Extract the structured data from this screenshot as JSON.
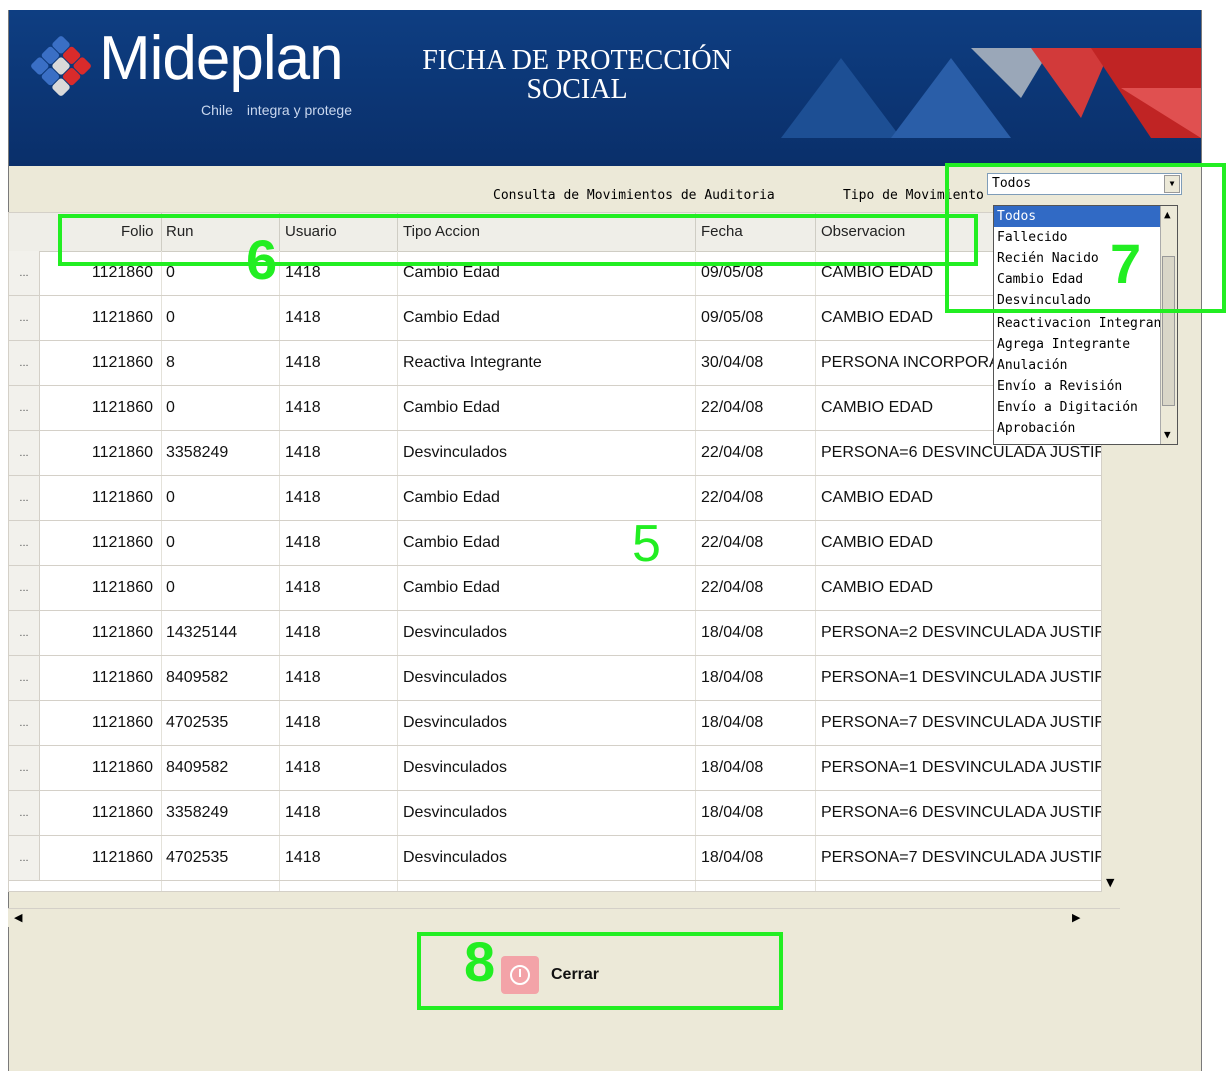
{
  "header": {
    "brand": "Mideplan",
    "tagline_left": "Chile",
    "tagline_right": "integra y protege",
    "title_line1": "FICHA DE PROTECCIÓN",
    "title_line2": "SOCIAL"
  },
  "toolbar": {
    "consulta_title": "Consulta de Movimientos de Auditoria",
    "tipo_label": "Tipo de Movimiento",
    "tipo_selected": "Todos"
  },
  "table": {
    "columns": [
      "Folio",
      "Run",
      "Usuario",
      "Tipo Accion",
      "Fecha",
      "Observacion"
    ],
    "rows": [
      [
        "1121860",
        "0",
        "1418",
        "Cambio Edad",
        "09/05/08",
        "CAMBIO EDAD"
      ],
      [
        "1121860",
        "0",
        "1418",
        "Cambio Edad",
        "09/05/08",
        "CAMBIO EDAD"
      ],
      [
        "1121860",
        "8",
        "1418",
        "Reactiva Integrante",
        "30/04/08",
        "PERSONA INCORPORAD"
      ],
      [
        "1121860",
        "0",
        "1418",
        "Cambio Edad",
        "22/04/08",
        "CAMBIO EDAD"
      ],
      [
        "1121860",
        "3358249",
        "1418",
        "Desvinculados",
        "22/04/08",
        "PERSONA=6 DESVINCULADA JUSTIF"
      ],
      [
        "1121860",
        "0",
        "1418",
        "Cambio Edad",
        "22/04/08",
        "CAMBIO EDAD"
      ],
      [
        "1121860",
        "0",
        "1418",
        "Cambio Edad",
        "22/04/08",
        "CAMBIO EDAD"
      ],
      [
        "1121860",
        "0",
        "1418",
        "Cambio Edad",
        "22/04/08",
        "CAMBIO EDAD"
      ],
      [
        "1121860",
        "14325144",
        "1418",
        "Desvinculados",
        "18/04/08",
        "PERSONA=2 DESVINCULADA JUSTIF"
      ],
      [
        "1121860",
        "8409582",
        "1418",
        "Desvinculados",
        "18/04/08",
        "PERSONA=1 DESVINCULADA JUSTIF"
      ],
      [
        "1121860",
        "4702535",
        "1418",
        "Desvinculados",
        "18/04/08",
        "PERSONA=7 DESVINCULADA JUSTIF"
      ],
      [
        "1121860",
        "8409582",
        "1418",
        "Desvinculados",
        "18/04/08",
        "PERSONA=1 DESVINCULADA JUSTIF"
      ],
      [
        "1121860",
        "3358249",
        "1418",
        "Desvinculados",
        "18/04/08",
        "PERSONA=6 DESVINCULADA JUSTIF"
      ],
      [
        "1121860",
        "4702535",
        "1418",
        "Desvinculados",
        "18/04/08",
        "PERSONA=7 DESVINCULADA JUSTIF"
      ]
    ],
    "row_selector": "..."
  },
  "dropdown": {
    "options": [
      "Todos",
      "Fallecido",
      "Recién Nacido",
      "Cambio Edad",
      "Desvinculado",
      "Reactivacion Integrante",
      "Agrega Integrante",
      "Anulación",
      "Envío a Revisión",
      "Envío a Digitación",
      "Aprobación"
    ],
    "active_index": 0
  },
  "annotations": {
    "n5": "5",
    "n6": "6",
    "n7": "7",
    "n8": "8",
    "color": "#22ee22"
  },
  "footer": {
    "close_label": "Cerrar"
  },
  "colors": {
    "header_blue": "#0e3e82",
    "window_bg": "#ECE9D8",
    "selection_blue": "#316ac5"
  },
  "icons": {
    "logo": "mideplan-diamond-logo",
    "close": "power-icon",
    "scroll_up": "triangle-up-icon",
    "scroll_down": "triangle-down-icon",
    "scroll_left": "triangle-left-icon",
    "scroll_right": "triangle-right-icon"
  }
}
